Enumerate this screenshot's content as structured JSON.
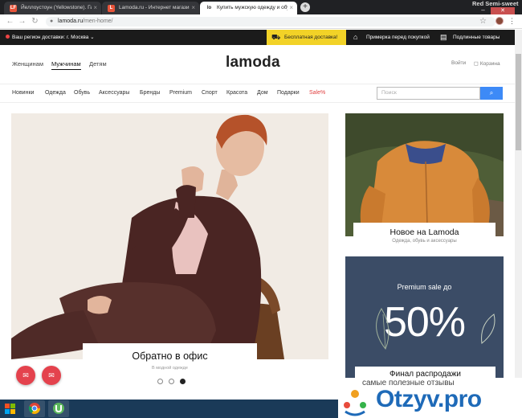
{
  "browser": {
    "tabs": [
      {
        "label": "Йеллоустоун (Yellowstone). Гид",
        "favicon": "LF",
        "favicon_color": "#e8543a"
      },
      {
        "label": "Lamoda.ru - Интернет магазин",
        "favicon": "L",
        "favicon_color": "#e8543a"
      },
      {
        "label": "Купить мужскую одежду и обу",
        "favicon": "lo",
        "favicon_color": "#222222"
      }
    ],
    "active_tab_index": 2,
    "new_tab": "+",
    "profile_name": "Red Semi-sweet",
    "url_host": "lamoda.ru",
    "url_path": "/men-home/",
    "icons": [
      "back-arrow-icon",
      "forward-arrow-icon",
      "reload-icon",
      "lock-icon",
      "star-icon",
      "menu-dots-icon"
    ]
  },
  "topbar": {
    "region_label": "Ваш регион доставки:",
    "region_city": "г. Москва",
    "promos": [
      {
        "label": "Бесплатная доставка!",
        "icon": "truck-icon",
        "highlight": true
      },
      {
        "label": "Примерка перед покупкой",
        "icon": "hanger-icon",
        "highlight": false
      },
      {
        "label": "Подлинные товары",
        "icon": "certificate-icon",
        "highlight": false
      }
    ]
  },
  "header": {
    "genders": [
      "Женщинам",
      "Мужчинам",
      "Детям"
    ],
    "active_gender": "Мужчинам",
    "logo": "lamoda",
    "login": "Войти",
    "cart": "Корзина"
  },
  "categories": [
    "Новинки",
    "Одежда",
    "Обувь",
    "Аксессуары",
    "Бренды",
    "Premium",
    "Спорт",
    "Красота",
    "Дом",
    "Подарки",
    "Sale%"
  ],
  "search": {
    "placeholder": "Поиск"
  },
  "hero": {
    "title": "Обратно в офис",
    "subtitle": "В модной одежде",
    "slides": 3,
    "active_slide": 3
  },
  "cards": [
    {
      "title": "Новое на Lamoda",
      "subtitle": "Одежда, обувь и аксессуары"
    },
    {
      "pre": "Premium sale до",
      "value": "50%",
      "caption": "Финал распродажи"
    }
  ],
  "watermark": {
    "tagline": "самые полезные отзывы",
    "logo": "Otzyv.pro"
  },
  "colors": {
    "accent": "#3d8af7",
    "sale": "#e04040",
    "promo_yellow": "#f2d227",
    "fab_red": "#e4424d",
    "premium_bg": "#3b4c66"
  }
}
